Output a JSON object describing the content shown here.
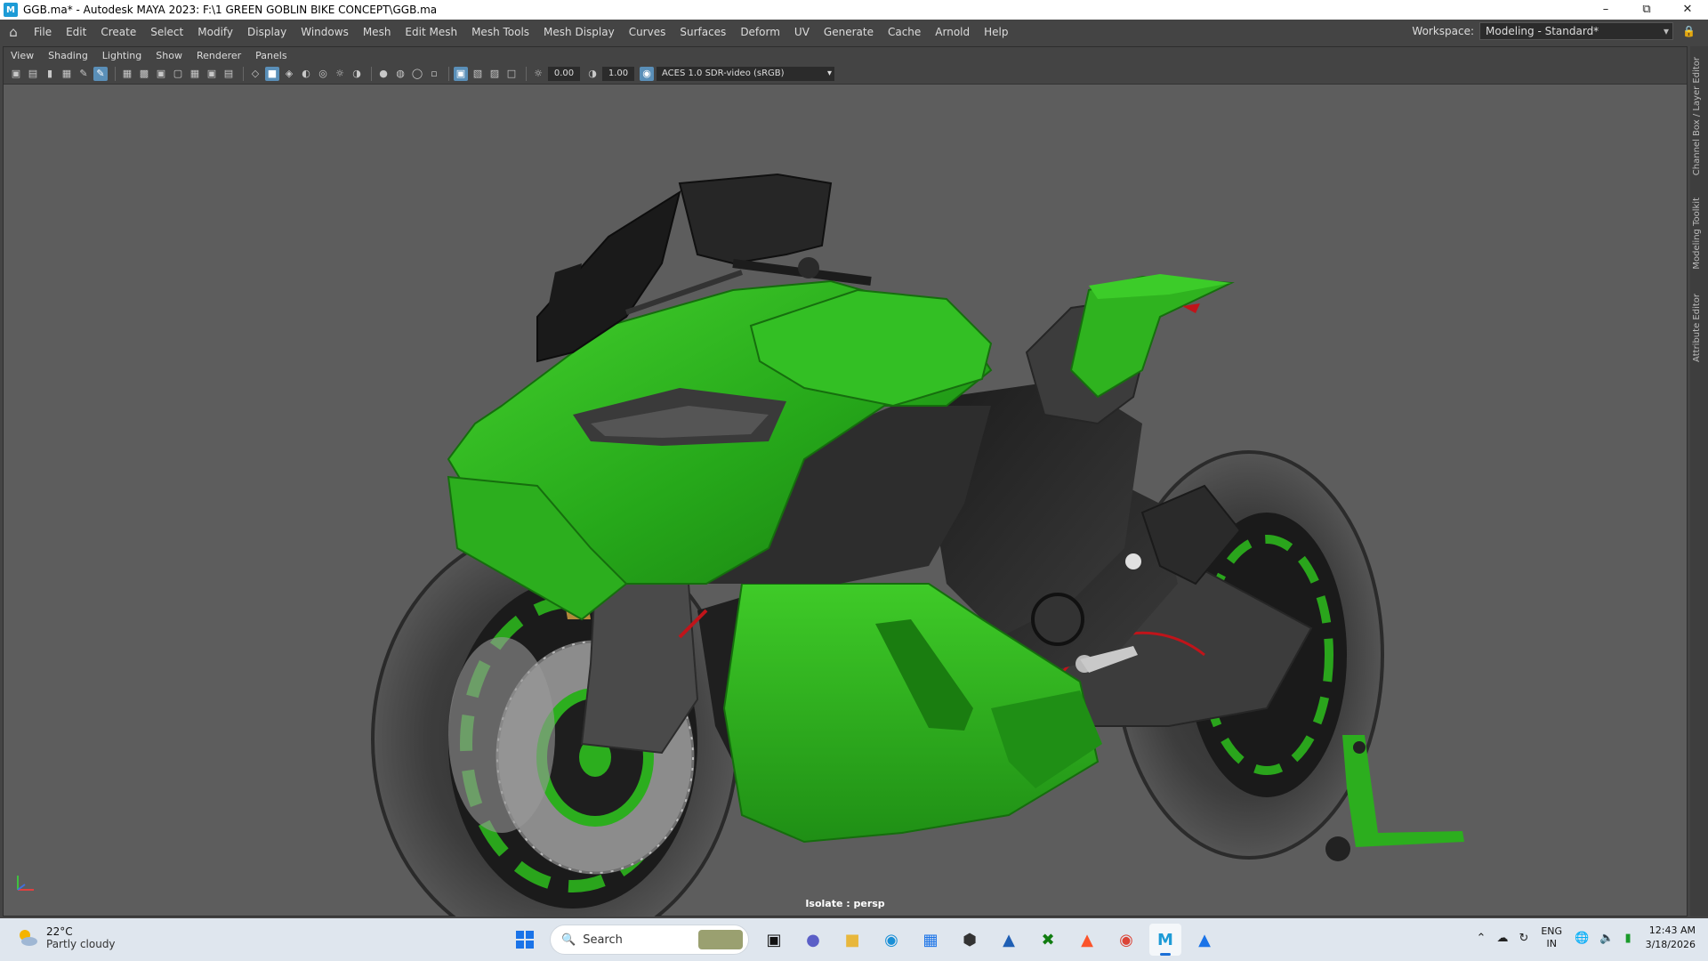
{
  "window": {
    "title": "GGB.ma* - Autodesk MAYA 2023: F:\\1 GREEN GOBLIN BIKE CONCEPT\\GGB.ma",
    "app_icon": "M",
    "minimize": "–",
    "restore": "⧉",
    "close": "✕"
  },
  "menubar": {
    "items": [
      "File",
      "Edit",
      "Create",
      "Select",
      "Modify",
      "Display",
      "Windows",
      "Mesh",
      "Edit Mesh",
      "Mesh Tools",
      "Mesh Display",
      "Curves",
      "Surfaces",
      "Deform",
      "UV",
      "Generate",
      "Cache",
      "Arnold",
      "Help"
    ],
    "workspace_label": "Workspace:",
    "workspace_value": "Modeling - Standard*"
  },
  "panel": {
    "menus": [
      "View",
      "Shading",
      "Lighting",
      "Show",
      "Renderer",
      "Panels"
    ],
    "exposure": "0.00",
    "gamma": "1.00",
    "colorspace": "ACES 1.0 SDR-video (sRGB)",
    "status": "Isolate : persp"
  },
  "sidetabs": [
    "Channel Box / Layer Editor",
    "Modeling Toolkit",
    "Attribute Editor"
  ],
  "colors": {
    "body_green": "#2fb31f",
    "body_dark": "#2a2a2a",
    "tire": "#3a3a3a",
    "viewport_bg": "#5d5d5d",
    "accent_red": "#c0141a"
  },
  "taskbar": {
    "temperature": "22°C",
    "weather": "Partly cloudy",
    "search_placeholder": "Search",
    "lang_top": "ENG",
    "lang_bottom": "IN",
    "time": "12:43 AM",
    "date": "3/18/2026"
  }
}
